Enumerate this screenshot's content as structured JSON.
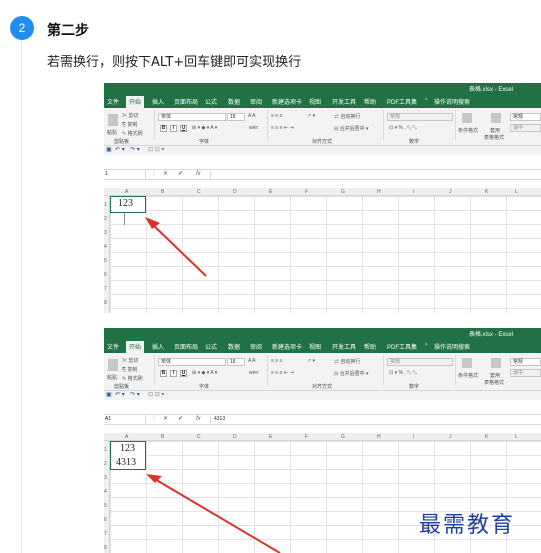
{
  "step": {
    "number": "2",
    "title": "第二步",
    "description": "若需换行，则按下ALT+回车键即可实现换行"
  },
  "excel": {
    "window_title": "表格.xlsx - Excel",
    "tabs": [
      "文件",
      "开始",
      "插入",
      "页面布局",
      "公式",
      "数据",
      "审阅",
      "新建选项卡",
      "视图",
      "开发工具",
      "帮助",
      "PDF工具集"
    ],
    "active_tab": "开始",
    "tell_me": "操作说明搜索",
    "clipboard": {
      "cut": "剪切",
      "copy": "复制",
      "format_painter": "格式刷",
      "paste": "粘贴",
      "group": "剪贴板"
    },
    "font": {
      "name": "宋体",
      "size": "18",
      "bold": "B",
      "italic": "I",
      "underline": "U",
      "group": "字体",
      "wen": "wén"
    },
    "alignment": {
      "wrap_text": "自动换行",
      "merge_center": "合并后居中",
      "group": "对齐方式"
    },
    "number": {
      "format": "常规",
      "group": "数字"
    },
    "styles": {
      "conditional": "条件格式",
      "format_as_table_line1": "套用",
      "format_as_table_line2": "表格格式",
      "normal": "常规",
      "neutral": "适中"
    },
    "columns": [
      "A",
      "B",
      "C",
      "D",
      "E",
      "F",
      "G",
      "H",
      "I",
      "J",
      "K",
      "L",
      "M"
    ],
    "rows": [
      "1",
      "2",
      "3",
      "4",
      "5",
      "6",
      "7",
      "8"
    ],
    "fx": "fx",
    "cancel": "✕",
    "enter": "✔"
  },
  "shot1": {
    "name_box": "1",
    "formula_value": "",
    "cell_a1": "123"
  },
  "shot2": {
    "name_box": "A1",
    "formula_value": "4313",
    "cell_a1_line1": "123",
    "cell_a1_line2": "4313"
  },
  "watermark": "最需教育",
  "colors": {
    "excel_green": "#207245",
    "badge_blue": "#1e8ff0",
    "arrow_red": "#e0302a",
    "watermark_blue": "#1f3fa0"
  }
}
